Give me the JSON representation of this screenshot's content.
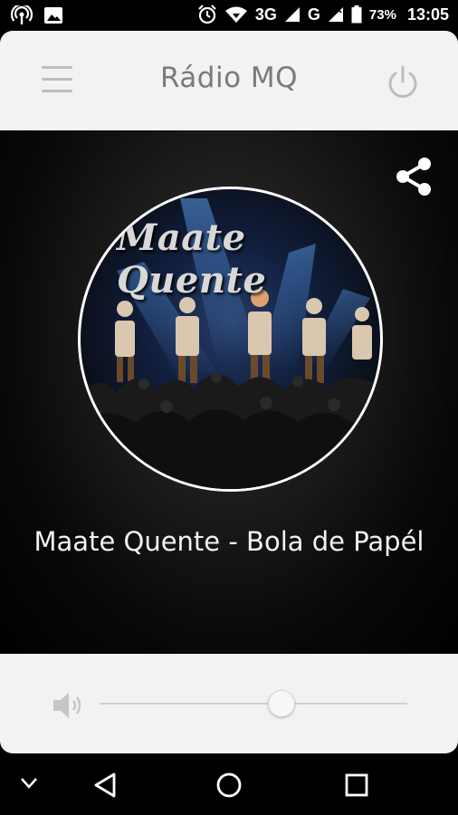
{
  "status_bar": {
    "network_3g": "3G",
    "network_g": "G",
    "battery": "73%",
    "time": "13:05",
    "icons": [
      "hotspot-icon",
      "image-icon",
      "alarm-icon",
      "wifi-icon",
      "signal-icon",
      "battery-icon"
    ]
  },
  "header": {
    "title": "Rádio MQ",
    "icons": [
      "menu-icon",
      "power-icon"
    ]
  },
  "player": {
    "cover_text": "Maate Quente",
    "track_title": "Maate Quente - Bola de Papél",
    "icons": [
      "share-icon"
    ]
  },
  "volume": {
    "level": 0.59,
    "icons": [
      "volume-icon"
    ]
  },
  "navigation": {
    "icons": [
      "chevron-down-icon",
      "back-icon",
      "home-icon",
      "recents-icon"
    ]
  },
  "colors": {
    "header_bg": "#f2f2f2",
    "title_text": "#7a7a7a",
    "player_bg": "#000000",
    "track_text": "#f2f2f2"
  }
}
